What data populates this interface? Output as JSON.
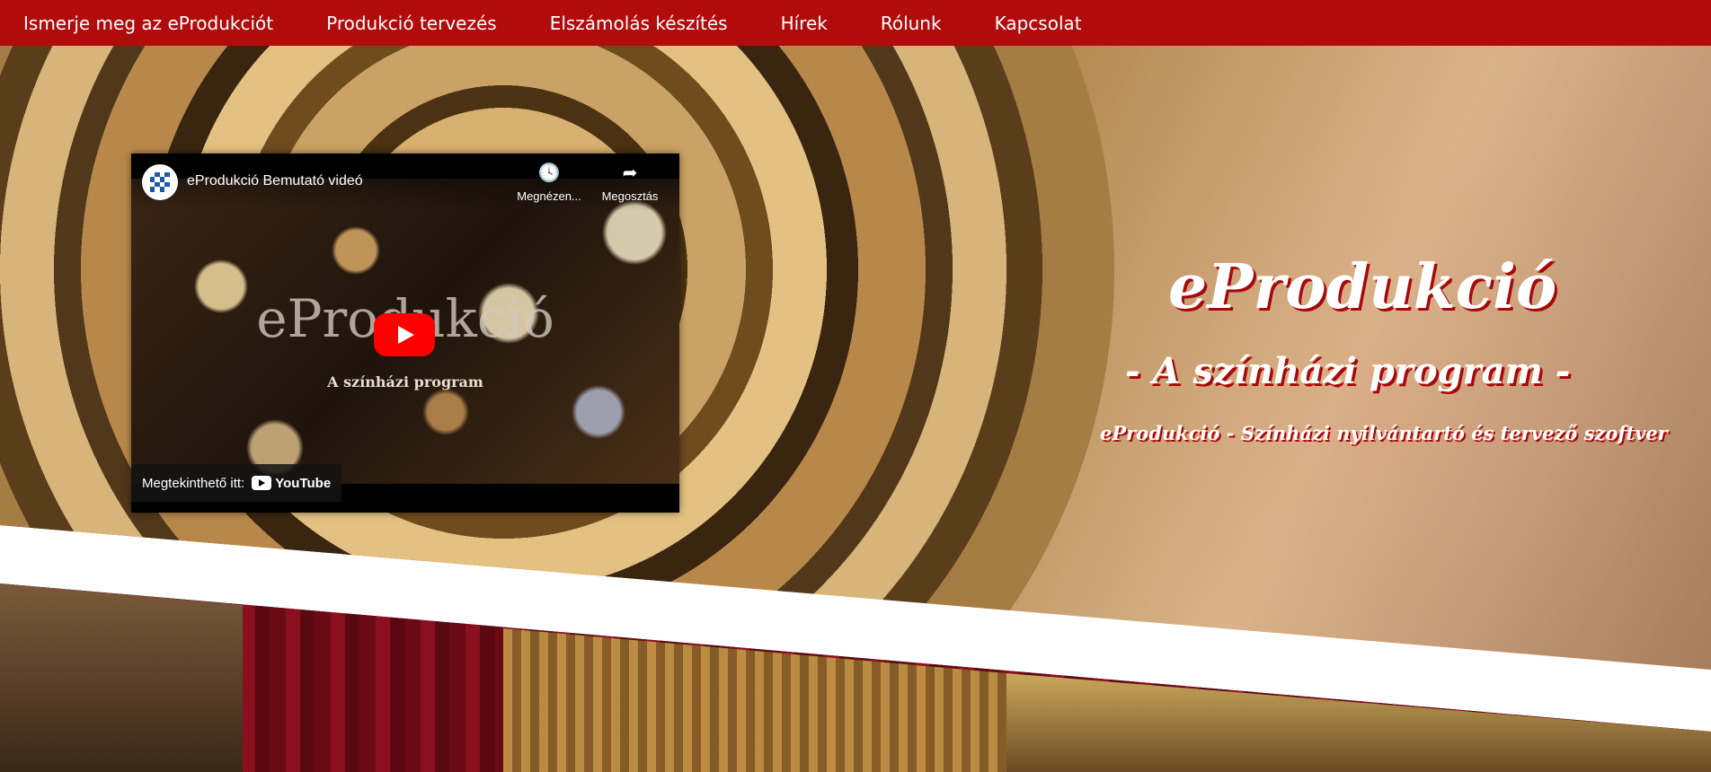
{
  "nav": {
    "items": [
      {
        "label": "Ismerje meg az eProdukciót"
      },
      {
        "label": "Produkció tervezés"
      },
      {
        "label": "Elszámolás készítés"
      },
      {
        "label": "Hírek"
      },
      {
        "label": "Rólunk"
      },
      {
        "label": "Kapcsolat"
      }
    ],
    "background": "#b10b0b"
  },
  "hero": {
    "title": "eProdukció",
    "subtitle": "- A színházi program -",
    "tagline": "eProdukció - Színházi nyilvántartó és tervező szoftver",
    "text_shadow_color": "#a8070b"
  },
  "video": {
    "title": "eProdukció Bemutató videó",
    "actions": [
      {
        "icon": "clock-icon",
        "label": "Megnézen..."
      },
      {
        "icon": "share-icon",
        "label": "Megosztás"
      }
    ],
    "watermark": "eProdukció",
    "watermark_sub": "A színházi program",
    "watch_on": "Megtekinthető itt:",
    "youtube_label": "YouTube"
  }
}
